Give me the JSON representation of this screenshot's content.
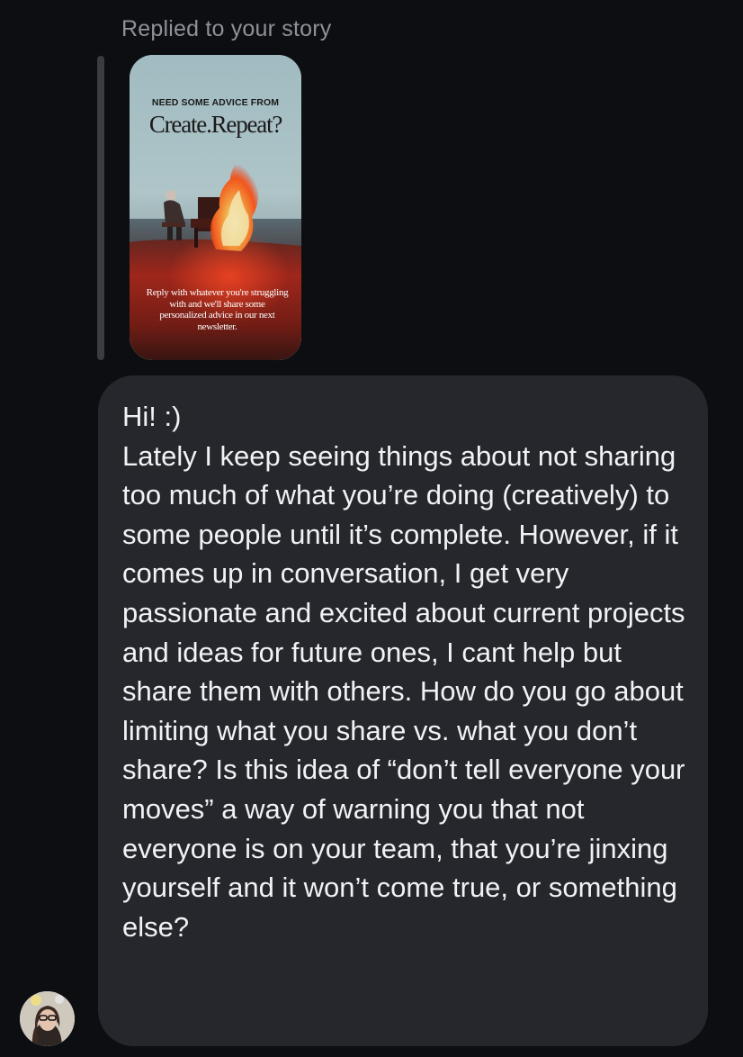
{
  "conversation": {
    "reply_context": "Replied to your story",
    "story": {
      "kicker": "NEED SOME ADVICE FROM",
      "brand": "Create.Repeat?",
      "caption": "Reply with whatever you're struggling with and we'll share some personalized advice in our next newsletter."
    },
    "message": {
      "text": "Hi! :)\nLately I keep seeing things about not sharing too much of what you’re doing (creatively) to some people until it’s complete. However, if it comes up in conversation, I get very passionate and excited about current projects and ideas for future ones, I cant help but share them with others. How do you go about limiting what you share vs. what you don’t share? Is this idea of “don’t tell everyone your moves” a way of warning you that not everyone is on your team, that you’re jinxing yourself and it won’t come true, or something else?"
    },
    "sender": {
      "avatar_icon": "profile-photo-avatar"
    }
  },
  "colors": {
    "background": "#0c0e12",
    "bubble": "#25272d",
    "reply_bar": "#3a3c42",
    "muted_text": "#8e9198",
    "message_text": "#f1f2f4"
  }
}
